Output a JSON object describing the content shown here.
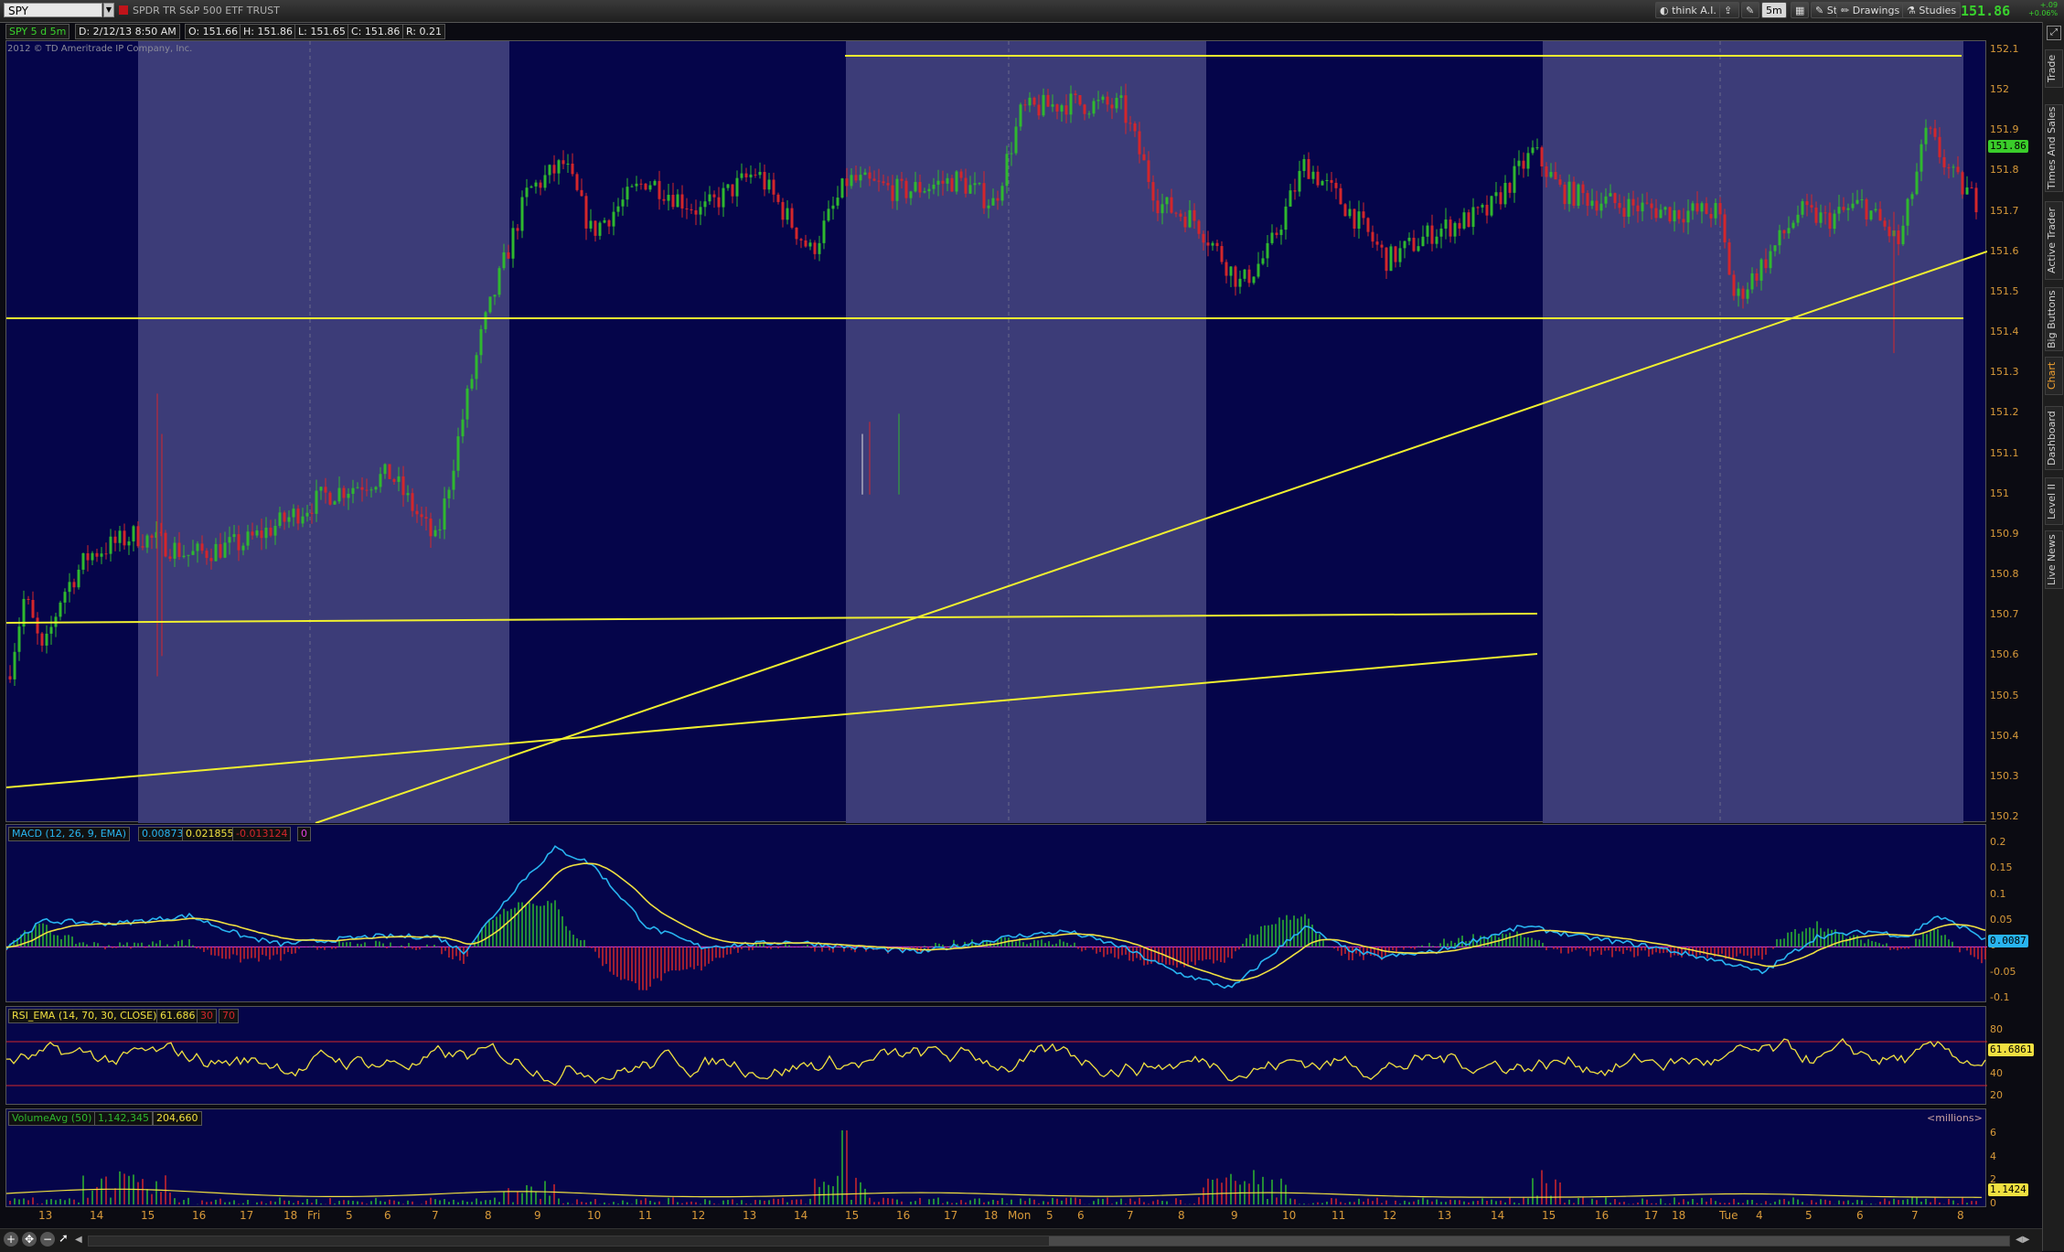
{
  "toolbar": {
    "symbol": "SPY",
    "description": "SPDR TR S&P 500 ETF TRUST",
    "buttons": [
      "think A.I.",
      "5m",
      "Style",
      "Drawings",
      "Studies"
    ],
    "last_price": "151.86",
    "net_change": "+.09",
    "net_pct": "+0.06%"
  },
  "info": {
    "period": "SPY 5 d 5m",
    "date": "D: 2/12/13 8:50 AM",
    "open": "O: 151.66",
    "high": "H: 151.86",
    "low": "L: 151.65",
    "close": "C: 151.86",
    "range": "R: 0.21"
  },
  "copyright": "2012 © TD Ameritrade IP Company, Inc.",
  "price_axis": {
    "ticks": [
      "152.1",
      "152",
      "151.9",
      "151.8",
      "151.7",
      "151.6",
      "151.5",
      "151.4",
      "151.3",
      "151.2",
      "151.1",
      "151",
      "150.9",
      "150.8",
      "150.7",
      "150.6",
      "150.5",
      "150.4",
      "150.3",
      "150.2"
    ],
    "last_badge": "151.86"
  },
  "macd": {
    "title": "MACD (12, 26, 9, EMA)",
    "value": "0.008731",
    "avg": "0.021855",
    "diff": "-0.013124",
    "zero": "0",
    "ticks": [
      "0.2",
      "0.15",
      "0.1",
      "0.05",
      "0",
      "-0.05",
      "-0.1"
    ],
    "badge": "0.0087"
  },
  "rsi": {
    "title": "RSI_EMA (14, 70, 30, CLOSE)",
    "value": "61.686",
    "oversold": "30",
    "overbought": "70",
    "ticks": [
      "80",
      "60",
      "40",
      "20"
    ],
    "badge": "61.6861"
  },
  "volume": {
    "title": "VolumeAvg (50)",
    "avg": "1,142,345",
    "value": "204,660",
    "unit": "<millions>",
    "ticks": [
      "6",
      "4",
      "2",
      "0"
    ],
    "badge": "1.1424"
  },
  "time_axis": [
    "13",
    "14",
    "15",
    "16",
    "17",
    "18",
    "Fri",
    "5",
    "6",
    "7",
    "8",
    "9",
    "10",
    "11",
    "12",
    "13",
    "14",
    "15",
    "16",
    "17",
    "18",
    "Mon",
    "5",
    "6",
    "7",
    "8",
    "9",
    "10",
    "11",
    "12",
    "13",
    "14",
    "15",
    "16",
    "17",
    "18",
    "Tue",
    "4",
    "5",
    "6",
    "7",
    "8"
  ],
  "side_tabs": [
    "Trade",
    "Times And Sales",
    "Active Trader",
    "Big Buttons",
    "Chart",
    "Dashboard",
    "Level II",
    "Live News"
  ],
  "colors": {
    "bg": "#05054a",
    "shade": "#3c3c78",
    "up": "#2fb82f",
    "down": "#d3262b",
    "trend": "#f0f030",
    "macd": "#28b4f0",
    "signal": "#f0e040",
    "axis": "#d89a3a"
  }
}
